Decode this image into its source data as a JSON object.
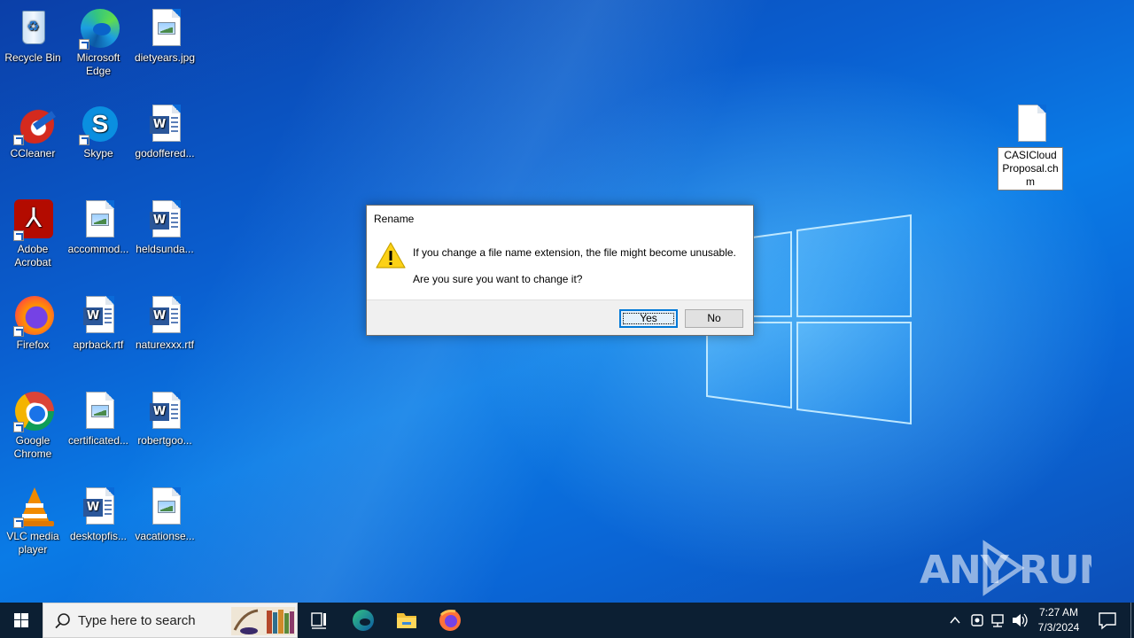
{
  "desktop": {
    "icons": [
      {
        "label": "Recycle Bin"
      },
      {
        "label": "Microsoft Edge"
      },
      {
        "label": "dietyears.jpg"
      },
      {
        "label": "CCleaner"
      },
      {
        "label": "Skype"
      },
      {
        "label": "godoffered..."
      },
      {
        "label": "Adobe Acrobat"
      },
      {
        "label": "accommod..."
      },
      {
        "label": "heldsunda..."
      },
      {
        "label": "Firefox"
      },
      {
        "label": "aprback.rtf"
      },
      {
        "label": "naturexxx.rtf"
      },
      {
        "label": "Google Chrome"
      },
      {
        "label": "certificated..."
      },
      {
        "label": "robertgoo..."
      },
      {
        "label": "VLC media player"
      },
      {
        "label": "desktopfis..."
      },
      {
        "label": "vacationse..."
      }
    ],
    "selected_file": {
      "label": "CASICloud Proposal.chm"
    },
    "watermark": "ANY RUN"
  },
  "dialog": {
    "title": "Rename",
    "message": "If you change a file name extension, the file might become unusable.",
    "question": "Are you sure you want to change it?",
    "yes_label": "Yes",
    "no_label": "No",
    "icon": "warning-icon"
  },
  "taskbar": {
    "search_placeholder": "Type here to search",
    "time": "7:27 AM",
    "date": "7/3/2024",
    "pinned": [
      "task-view-icon",
      "edge-icon",
      "file-explorer-icon",
      "firefox-icon"
    ]
  },
  "colors": {
    "accent": "#0078d7",
    "taskbar": "#0c1f33",
    "desktop": "#0a63c9"
  }
}
